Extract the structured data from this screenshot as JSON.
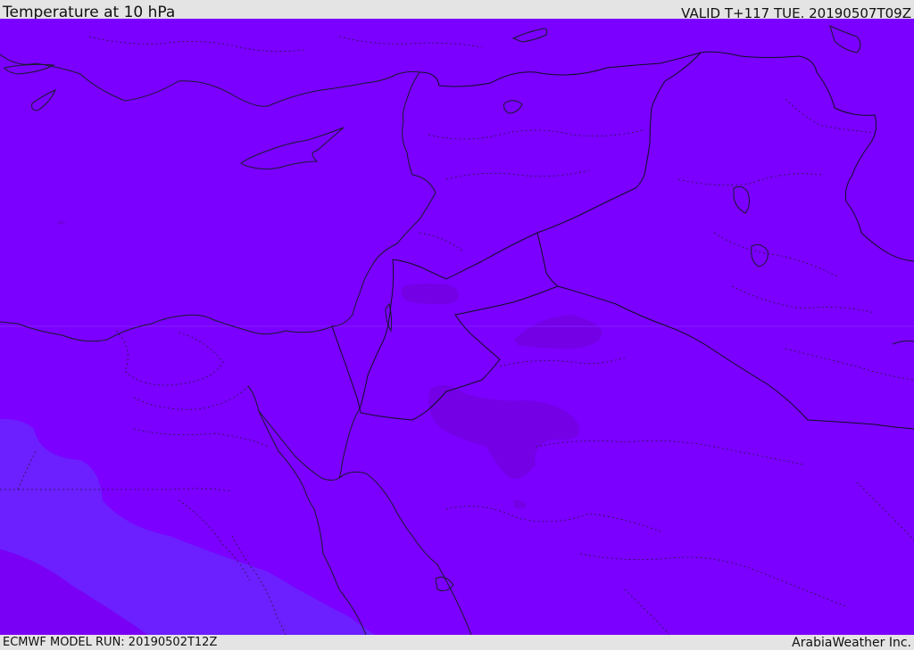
{
  "header": {
    "title": "Temperature at 10 hPa",
    "valid": "VALID T+117 TUE. 20190507T09Z"
  },
  "footer": {
    "model_run": "ECMWF MODEL RUN: 20190502T12Z",
    "credit": "ArabiaWeather Inc."
  },
  "colors": {
    "field_main": "#7b00ff",
    "field_cool": "#6c1fff",
    "field_warm": "#7400e6",
    "coastline": "#1a1a2e",
    "bar_background": "#e4e4e4"
  }
}
